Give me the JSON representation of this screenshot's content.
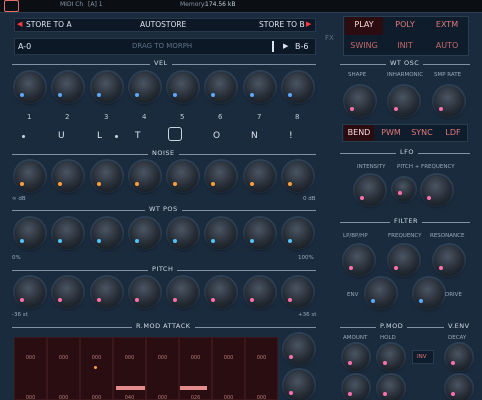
{
  "topbar": {
    "midi": "MIDI Ch",
    "channel": "[A] 1",
    "memory_label": "Memory:",
    "memory_value": "174.56 kB"
  },
  "store": {
    "a": "STORE TO A",
    "autostore": "AUTOSTORE",
    "b": "STORE TO B"
  },
  "morph": {
    "left": "A-0",
    "center": "DRAG TO MORPH",
    "right": "B-6"
  },
  "fx": "FX",
  "modes": {
    "row1": [
      "PLAY",
      "POLY",
      "EXTM"
    ],
    "row2": [
      "SWING",
      "INIT",
      "AUTO"
    ]
  },
  "sections": {
    "vel": "VEL",
    "noise": "NOISE",
    "wtpos": "WT POS",
    "pitch": "PITCH",
    "rmod": "R.MOD ATTACK",
    "wtosc": "WT OSC",
    "lfo": "LFO",
    "filter": "FILTER",
    "pmod": "P.MOD",
    "venv": "V.ENV"
  },
  "steps": [
    "1",
    "2",
    "3",
    "4",
    "5",
    "6",
    "7",
    "8"
  ],
  "word": [
    "U",
    "L",
    "T",
    "",
    "O",
    "N",
    "!"
  ],
  "noise": {
    "min": "∞ dB",
    "max": "0 dB"
  },
  "wtpos": {
    "min": "0%",
    "max": "100%"
  },
  "pitch": {
    "min": "-36 st",
    "max": "+36 st"
  },
  "osc": {
    "labels": [
      "SHAPE",
      "INHARMONIC",
      "SMP RATE"
    ],
    "tabs": [
      "BEND",
      "PWM",
      "SYNC",
      "LDF"
    ]
  },
  "lfo": {
    "intensity": "INTENSITY",
    "pf": "PITCH + FREQUENCY"
  },
  "filter": {
    "mode": "LP/BP/HP",
    "frequency": "FREQUENCY",
    "resonance": "RESONANCE",
    "env": "ENV",
    "drive": "DRIVE"
  },
  "pmod": {
    "amount": "AMOUNT",
    "hold": "HOLD",
    "inv": "INV",
    "decay": "DECAY"
  },
  "rmod_values": [
    "000",
    "000",
    "000",
    "000",
    "000",
    "000",
    "000",
    "000"
  ],
  "rmod_values2": [
    "000",
    "000",
    "000",
    "040",
    "000",
    "026",
    "000",
    "000"
  ],
  "colors": {
    "accent": "#ff3b3b",
    "vel": "#5aa8ff",
    "noise": "#ff9e3d",
    "wtpos": "#4ec3ff",
    "pitch": "#ff6fb0"
  }
}
